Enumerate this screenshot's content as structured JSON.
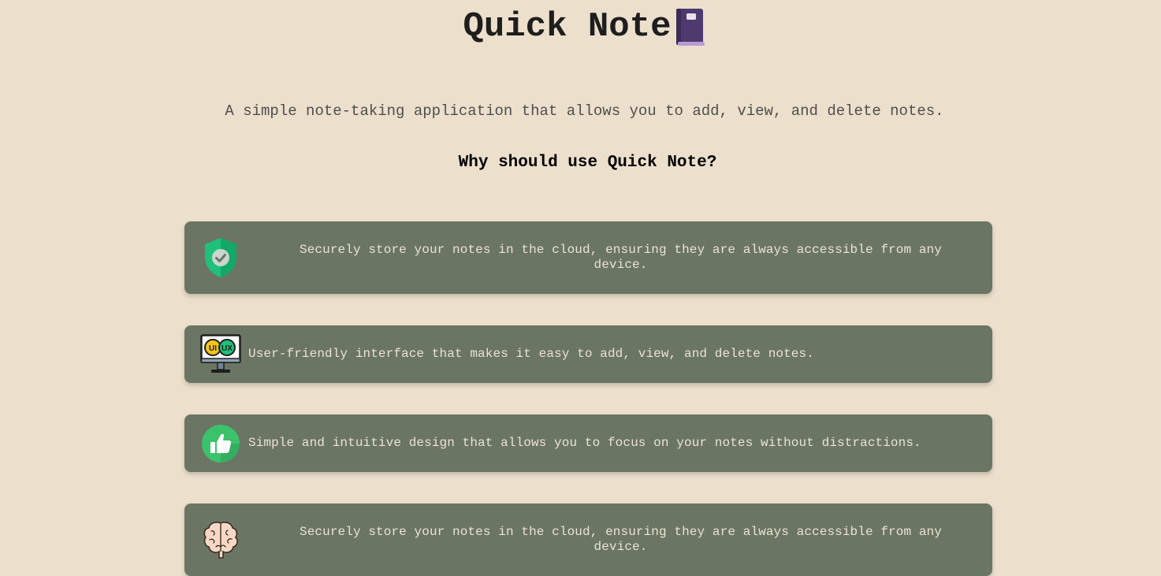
{
  "header": {
    "title": "Quick Note",
    "title_icon": "notebook-icon"
  },
  "subtitle": "A simple note-taking application that allows you to add, view, and delete notes.",
  "why_heading": "Why should use Quick Note?",
  "features": [
    {
      "icon": "shield-check-icon",
      "text": "Securely store your notes in the cloud, ensuring they are always accessible from any device."
    },
    {
      "icon": "ui-ux-monitor-icon",
      "text": "User-friendly interface that makes it easy to add, view, and delete notes."
    },
    {
      "icon": "thumbs-up-icon",
      "text": "Simple and intuitive design that allows you to focus on your notes without distractions."
    },
    {
      "icon": "brain-icon",
      "text": "Securely store your notes in the cloud, ensuring they are always accessible from any device."
    }
  ],
  "colors": {
    "background": "#ecdfcc",
    "card": "#6b7563",
    "card_text": "#ece3d3",
    "accent_green": "#2ecc71",
    "notebook_purple": "#4e3a6e"
  }
}
